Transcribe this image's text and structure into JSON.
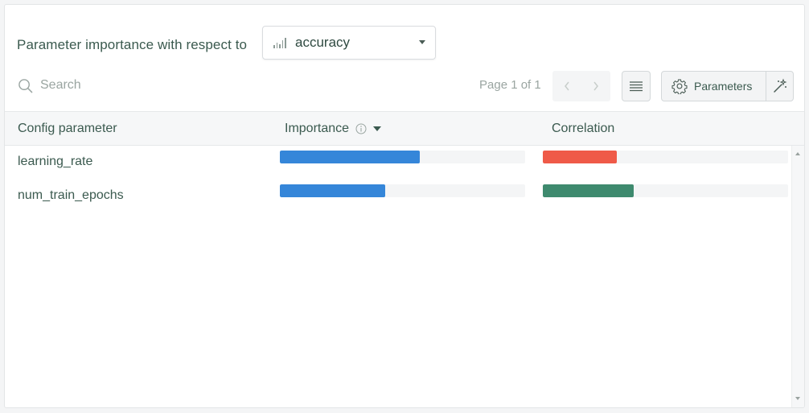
{
  "header": {
    "title": "Parameter importance with respect to",
    "metric_select": {
      "value": "accuracy",
      "icon": "bar-chart-icon"
    }
  },
  "toolbar": {
    "search_placeholder": "Search",
    "page_info": "Page 1 of 1",
    "prev_icon": "chevron-left-icon",
    "next_icon": "chevron-right-icon",
    "list_icon": "list-icon",
    "parameters_label": "Parameters",
    "parameters_icon": "gear-icon",
    "wand_icon": "magic-wand-icon"
  },
  "table": {
    "columns": {
      "config": "Config parameter",
      "importance": "Importance",
      "correlation": "Correlation"
    },
    "rows": [
      {
        "name": "learning_rate",
        "importance": 0.57,
        "correlation": -0.3
      },
      {
        "name": "num_train_epochs",
        "importance": 0.43,
        "correlation": 0.37
      }
    ]
  },
  "colors": {
    "importance": "#3586d9",
    "correlation_negative": "#ef5a48",
    "correlation_positive": "#3e8a6e",
    "text": "#3b5a4f"
  }
}
